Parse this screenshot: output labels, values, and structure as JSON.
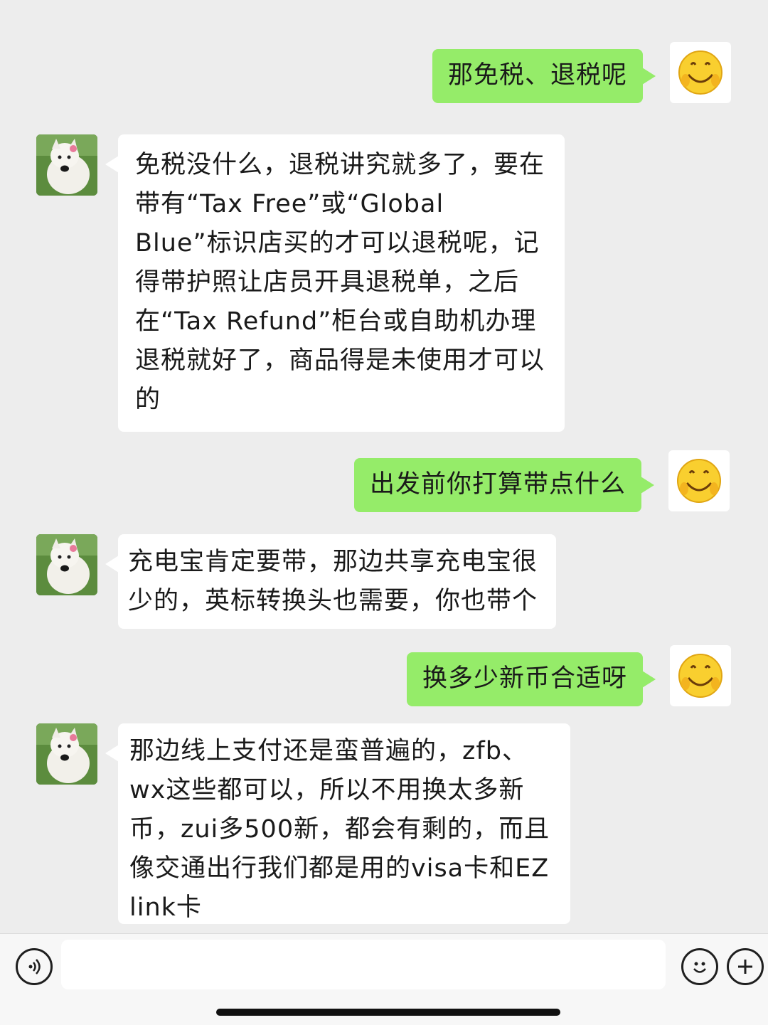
{
  "messages": [
    {
      "sender": "me",
      "avatar_icon": "smiley-emoji-icon",
      "text": "那免税、退税呢"
    },
    {
      "sender": "other",
      "avatar_icon": "white-dog-avatar",
      "text": "免税没什么，退税讲究就多了，要在带有“Tax Free”或“Global Blue”标识店买的才可以退税呢，记得带护照让店员开具退税单，之后在“Tax Refund”柜台或自助机办理退税就好了，商品得是未使用才可以的"
    },
    {
      "sender": "me",
      "avatar_icon": "smiley-emoji-icon",
      "text": "出发前你打算带点什么"
    },
    {
      "sender": "other",
      "avatar_icon": "white-dog-avatar",
      "text": "充电宝肯定要带，那边共享充电宝很少的，英标转换头也需要，你也带个"
    },
    {
      "sender": "me",
      "avatar_icon": "smiley-emoji-icon",
      "text": "换多少新币合适呀"
    },
    {
      "sender": "other",
      "avatar_icon": "white-dog-avatar",
      "text": "那边线上支付还是蛮普遍的，zfb、wx这些都可以，所以不用换太多新币，zui多500新，都会有剩的，而且像交通出行我们都是用的visa卡和EZ link卡"
    }
  ],
  "input_bar": {
    "voice_icon": "voice-icon",
    "input_value": "",
    "emoji_icon": "emoji-icon",
    "add_icon": "plus-icon"
  },
  "colors": {
    "background": "#ededed",
    "my_bubble": "#95ec69",
    "their_bubble": "#ffffff"
  }
}
